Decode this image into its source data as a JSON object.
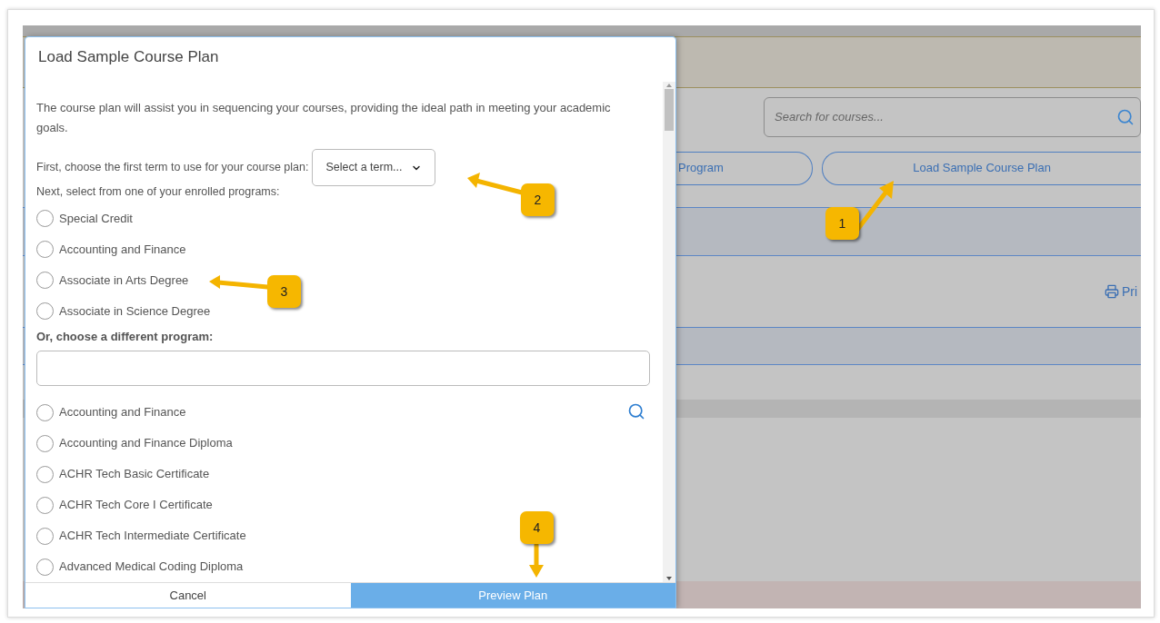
{
  "background_page": {
    "search": {
      "placeholder": "Search for courses..."
    },
    "buttons": [
      {
        "label": "Program"
      },
      {
        "label": "Load Sample Course Plan"
      }
    ],
    "print_link": "Pri"
  },
  "dialog": {
    "title": "Load Sample Course Plan",
    "intro": "The course plan will assist you in sequencing your courses, providing the ideal path in meeting your academic goals.",
    "term_label": "First, choose the first term to use for your course plan:",
    "term_select": {
      "value": "Select a term..."
    },
    "enrolled_label": "Next, select from one of your enrolled programs:",
    "enrolled_programs": [
      {
        "label": "Special Credit",
        "selected": false
      },
      {
        "label": "Accounting and Finance",
        "selected": false
      },
      {
        "label": "Associate in Arts Degree",
        "selected": false
      },
      {
        "label": "Associate in Science Degree",
        "selected": false
      }
    ],
    "other_label": "Or, choose a different program:",
    "other_programs": [
      {
        "label": "Accounting and Finance",
        "selected": false
      },
      {
        "label": "Accounting and Finance Diploma",
        "selected": false
      },
      {
        "label": "ACHR Tech Basic Certificate",
        "selected": false
      },
      {
        "label": "ACHR Tech Core I Certificate",
        "selected": false
      },
      {
        "label": "ACHR Tech Intermediate Certificate",
        "selected": false
      },
      {
        "label": "Advanced Medical Coding Diploma",
        "selected": false
      }
    ],
    "buttons": [
      {
        "label": "Cancel",
        "kind": "secondary"
      },
      {
        "label": "Preview Plan",
        "kind": "primary"
      }
    ]
  },
  "callouts": [
    {
      "label": "1"
    },
    {
      "label": "2"
    },
    {
      "label": "3"
    },
    {
      "label": "4"
    }
  ]
}
